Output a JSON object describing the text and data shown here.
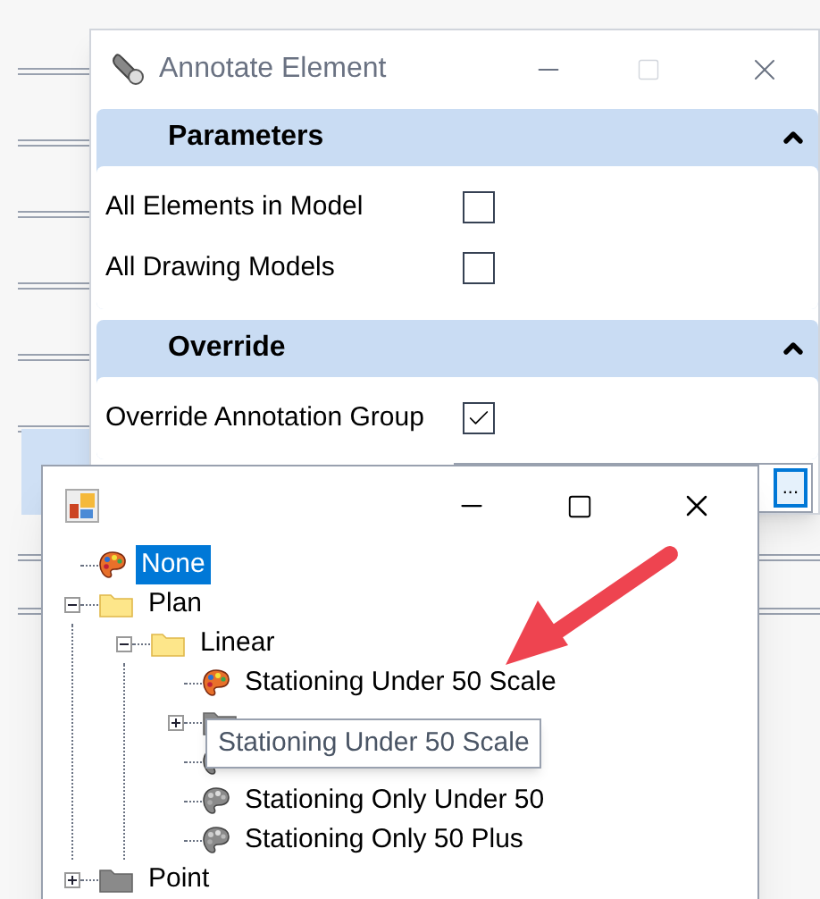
{
  "dialog": {
    "title": "Annotate Element",
    "sections": [
      {
        "title": "Parameters",
        "expanded": true,
        "rows": [
          {
            "label": "All Elements in Model",
            "checked": false
          },
          {
            "label": "All Drawing Models",
            "checked": false
          }
        ]
      },
      {
        "title": "Override",
        "expanded": true,
        "rows": [
          {
            "label": "Override Annotation Group",
            "checked": true
          }
        ]
      }
    ],
    "browse_button": "..."
  },
  "picker": {
    "tree": [
      {
        "kind": "style",
        "label": "None",
        "active": true,
        "selected": true
      },
      {
        "kind": "folder",
        "label": "Plan",
        "expanded": true,
        "selected": false,
        "children": [
          {
            "kind": "folder",
            "label": "Linear",
            "expanded": true,
            "selected": false,
            "children": [
              {
                "kind": "style",
                "label": "Stationing Under 50 Scale",
                "active": true,
                "selected": false
              },
              {
                "kind": "folder",
                "expanded": false
              },
              {
                "kind": "style",
                "active": false
              },
              {
                "kind": "style",
                "label": "Stationing Only Under 50",
                "active": false,
                "selected": false
              },
              {
                "kind": "style",
                "label": "Stationing Only 50 Plus",
                "active": false,
                "selected": false
              }
            ]
          }
        ]
      },
      {
        "kind": "folder",
        "label": "Point",
        "expanded": false,
        "selected": false
      }
    ]
  },
  "tooltip": "Stationing Under 50 Scale"
}
